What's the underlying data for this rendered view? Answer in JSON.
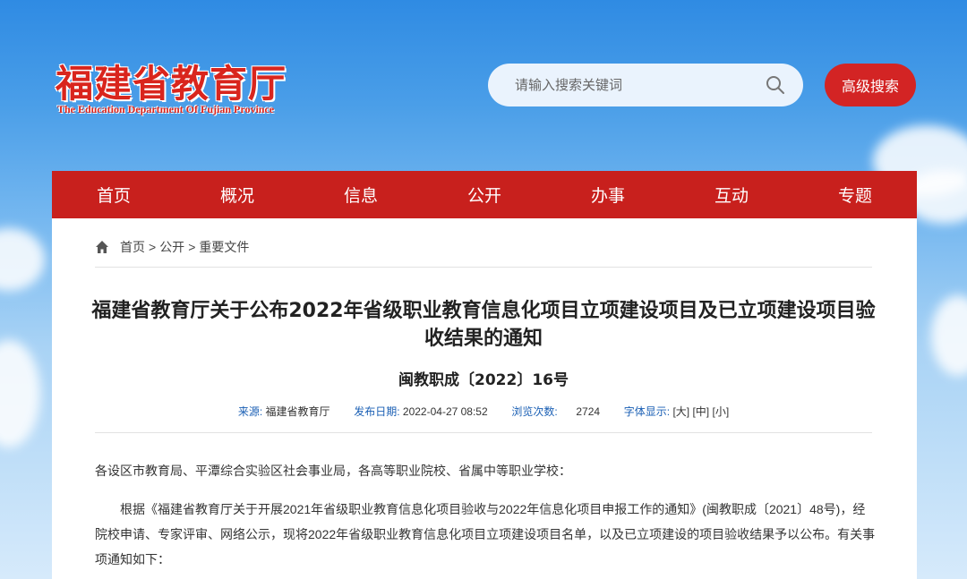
{
  "header": {
    "logo_cn": "福建省教育厅",
    "logo_en": "The Education Department Of Fujian Province",
    "search_placeholder": "请输入搜索关键词",
    "advanced_search_label": "高级搜索"
  },
  "nav": {
    "items": [
      {
        "label": "首页"
      },
      {
        "label": "概况"
      },
      {
        "label": "信息"
      },
      {
        "label": "公开"
      },
      {
        "label": "办事"
      },
      {
        "label": "互动"
      },
      {
        "label": "专题"
      }
    ]
  },
  "breadcrumb": {
    "items": [
      "首页",
      "公开",
      "重要文件"
    ],
    "separator": ">"
  },
  "article": {
    "title": "福建省教育厅关于公布2022年省级职业教育信息化项目立项建设项目及已立项建设项目验收结果的通知",
    "doc_number": "闽教职成〔2022〕16号",
    "meta": {
      "source_label": "来源:",
      "source_value": "福建省教育厅",
      "date_label": "发布日期:",
      "date_value": "2022-04-27 08:52",
      "views_label": "浏览次数:",
      "views_value": "2724",
      "font_label": "字体显示:",
      "font_large": "[大]",
      "font_medium": "[中]",
      "font_small": "[小]"
    },
    "paragraphs": [
      "各设区市教育局、平潭综合实验区社会事业局，各高等职业院校、省属中等职业学校：",
      "根据《福建省教育厅关于开展2021年省级职业教育信息化项目验收与2022年信息化项目申报工作的通知》(闽教职成〔2021〕48号)，经院校申请、专家评审、网络公示，现将2022年省级职业教育信息化项目立项建设项目名单，以及已立项建设的项目验收结果予以公布。有关事项通知如下："
    ]
  },
  "colors": {
    "brand_red": "#c8201d",
    "link_blue": "#1a5fb4"
  }
}
